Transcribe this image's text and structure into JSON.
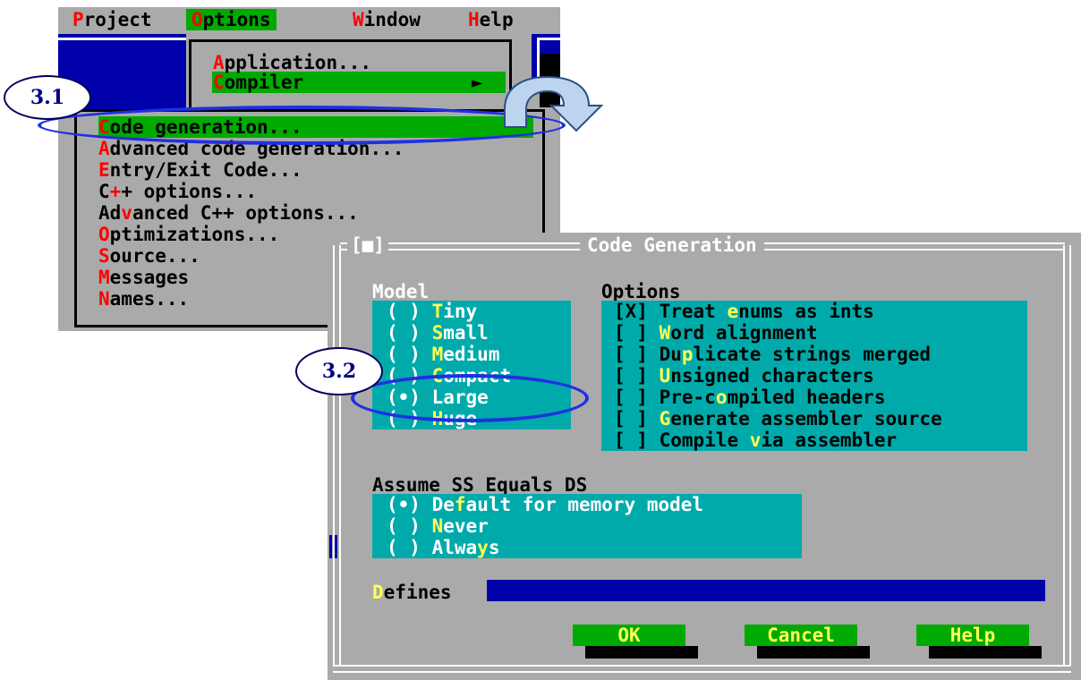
{
  "menubar": {
    "items": [
      {
        "hot": "P",
        "rest": "roject"
      },
      {
        "hot": "O",
        "rest": "ptions"
      },
      {
        "hot": "W",
        "rest": "indow"
      },
      {
        "hot": "H",
        "rest": "elp"
      }
    ],
    "selected": "Options"
  },
  "options_menu": {
    "items": [
      {
        "hot": "A",
        "rest": "pplication..."
      },
      {
        "hot": "C",
        "rest": "ompiler",
        "arrow": "►"
      }
    ]
  },
  "compiler_submenu": {
    "items": [
      {
        "pre": "",
        "hot": "C",
        "rest": "ode generation..."
      },
      {
        "pre": "",
        "hot": "A",
        "rest": "dvanced code generation..."
      },
      {
        "pre": "",
        "hot": "E",
        "rest": "ntry/Exit Code..."
      },
      {
        "pre": "C",
        "hot": "+",
        "rest": "+ options..."
      },
      {
        "pre": "Ad",
        "hot": "v",
        "rest": "anced C++ options..."
      },
      {
        "pre": "",
        "hot": "O",
        "rest": "ptimizations..."
      },
      {
        "pre": "",
        "hot": "S",
        "rest": "ource..."
      },
      {
        "pre": "",
        "hot": "M",
        "rest": "essages"
      },
      {
        "pre": "",
        "hot": "N",
        "rest": "ames..."
      }
    ]
  },
  "dialog": {
    "title": "Code Generation",
    "close_box": "[■]",
    "model": {
      "label": "Model",
      "options": [
        {
          "mark": "( )",
          "pre": "",
          "hot": "T",
          "rest": "iny"
        },
        {
          "mark": "( )",
          "pre": "",
          "hot": "S",
          "rest": "mall"
        },
        {
          "mark": "( )",
          "pre": "",
          "hot": "M",
          "rest": "edium"
        },
        {
          "mark": "( )",
          "pre": "",
          "hot": "C",
          "rest": "ompact"
        },
        {
          "mark": "(•)",
          "pre": "",
          "hot": "",
          "rest": "Large"
        },
        {
          "mark": "( )",
          "pre": "",
          "hot": "H",
          "rest": "uge"
        }
      ],
      "selected": "Large"
    },
    "options": {
      "label": "Options",
      "items": [
        {
          "mark": "[X]",
          "pre": "Treat ",
          "hot": "e",
          "rest": "nums as ints"
        },
        {
          "mark": "[ ]",
          "pre": "",
          "hot": "W",
          "rest": "ord alignment"
        },
        {
          "mark": "[ ]",
          "pre": "Du",
          "hot": "p",
          "rest": "licate strings merged"
        },
        {
          "mark": "[ ]",
          "pre": "",
          "hot": "U",
          "rest": "nsigned characters"
        },
        {
          "mark": "[ ]",
          "pre": "Pre-c",
          "hot": "o",
          "rest": "mpiled headers"
        },
        {
          "mark": "[ ]",
          "pre": "",
          "hot": "G",
          "rest": "enerate assembler source"
        },
        {
          "mark": "[ ]",
          "pre": "Compile ",
          "hot": "v",
          "rest": "ia assembler"
        }
      ]
    },
    "assume": {
      "label": "Assume SS Equals DS",
      "options": [
        {
          "mark": "(•)",
          "pre": "De",
          "hot": "f",
          "rest": "ault for memory model"
        },
        {
          "mark": "( )",
          "pre": "",
          "hot": "N",
          "rest": "ever"
        },
        {
          "mark": "( )",
          "pre": "Alwa",
          "hot": "y",
          "rest": "s"
        }
      ]
    },
    "defines": {
      "hot": "D",
      "rest": "efines",
      "value": ""
    },
    "buttons": {
      "ok": "OK",
      "cancel": "Cancel",
      "help": "Help"
    }
  },
  "annotations": {
    "step1": "3.1",
    "step2": "3.2"
  },
  "colors": {
    "dos_gray": "#aaaaaa",
    "dos_green": "#00aa00",
    "dos_cyan": "#00aaaa",
    "dos_blue": "#0000aa",
    "hotkey_red": "#ff0000",
    "hotkey_yellow": "#ffff55",
    "ring_blue": "#2030e0"
  },
  "icons": {
    "submenu_arrow": "triangle-right-icon",
    "curved_arrow": "curved-arrow-icon"
  }
}
